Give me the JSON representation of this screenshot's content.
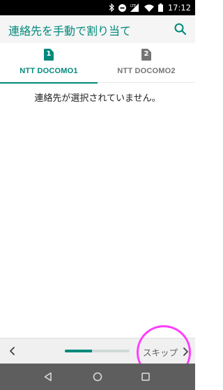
{
  "status_bar": {
    "time": "17:12",
    "icons": [
      "bluetooth-icon",
      "do-not-disturb-icon",
      "lte-signal-icon",
      "wifi-icon",
      "battery-icon"
    ],
    "lte_label": "LTE"
  },
  "toolbar": {
    "title": "連絡先を手動で割り当て",
    "search_icon": "search-icon",
    "accent_color": "#00897b"
  },
  "sim_tabs": [
    {
      "number": "1",
      "label": "NTT DOCOMO1",
      "selected": true
    },
    {
      "number": "2",
      "label": "NTT DOCOMO2",
      "selected": false
    }
  ],
  "main": {
    "empty_message": "連絡先が選択されていません。"
  },
  "bottom_nav": {
    "back_icon": "chevron-left-icon",
    "progress": 0.42,
    "skip_label": "スキップ",
    "skip_icon": "chevron-right-icon",
    "highlight_color": "#ff3dff"
  },
  "system_nav": {
    "icons": [
      "back-triangle-icon",
      "home-circle-icon",
      "recents-square-icon"
    ]
  }
}
